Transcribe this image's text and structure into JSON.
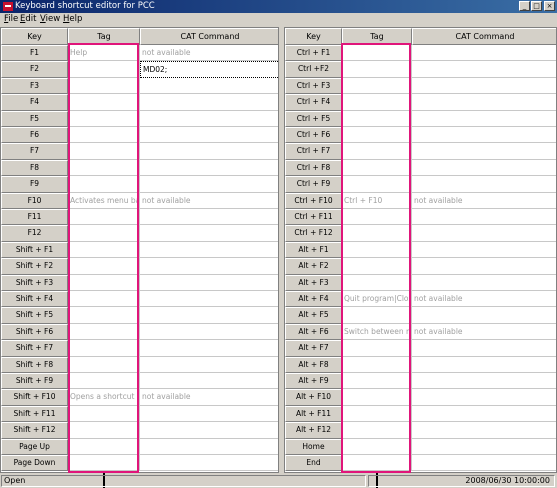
{
  "window": {
    "title": "Keyboard shortcut editor for PCC",
    "buttons": [
      "_",
      "□",
      "×"
    ]
  },
  "menu": [
    "File",
    "Edit",
    "View",
    "Help"
  ],
  "columns": [
    "Key",
    "Tag",
    "CAT Command"
  ],
  "left_table": {
    "rows": [
      {
        "key": "F1",
        "tag": "Help",
        "cat": "not available"
      },
      {
        "key": "F2",
        "tag": "",
        "cat": "MD02;"
      },
      {
        "key": "F3",
        "tag": "",
        "cat": ""
      },
      {
        "key": "F4",
        "tag": "",
        "cat": ""
      },
      {
        "key": "F5",
        "tag": "",
        "cat": ""
      },
      {
        "key": "F6",
        "tag": "",
        "cat": ""
      },
      {
        "key": "F7",
        "tag": "",
        "cat": ""
      },
      {
        "key": "F8",
        "tag": "",
        "cat": ""
      },
      {
        "key": "F9",
        "tag": "",
        "cat": ""
      },
      {
        "key": "F10",
        "tag": "Activates menu bar",
        "cat": "not available"
      },
      {
        "key": "F11",
        "tag": "",
        "cat": ""
      },
      {
        "key": "F12",
        "tag": "",
        "cat": ""
      },
      {
        "key": "Shift + F1",
        "tag": "",
        "cat": ""
      },
      {
        "key": "Shift + F2",
        "tag": "",
        "cat": ""
      },
      {
        "key": "Shift + F3",
        "tag": "",
        "cat": ""
      },
      {
        "key": "Shift + F4",
        "tag": "",
        "cat": ""
      },
      {
        "key": "Shift + F5",
        "tag": "",
        "cat": ""
      },
      {
        "key": "Shift + F6",
        "tag": "",
        "cat": ""
      },
      {
        "key": "Shift + F7",
        "tag": "",
        "cat": ""
      },
      {
        "key": "Shift + F8",
        "tag": "",
        "cat": ""
      },
      {
        "key": "Shift + F9",
        "tag": "",
        "cat": ""
      },
      {
        "key": "Shift + F10",
        "tag": "Opens a shortcut m",
        "cat": "not available"
      },
      {
        "key": "Shift + F11",
        "tag": "",
        "cat": ""
      },
      {
        "key": "Shift + F12",
        "tag": "",
        "cat": ""
      },
      {
        "key": "Page Up",
        "tag": "",
        "cat": ""
      },
      {
        "key": "Page Down",
        "tag": "",
        "cat": ""
      }
    ]
  },
  "right_table": {
    "rows": [
      {
        "key": "Ctrl + F1",
        "tag": "",
        "cat": ""
      },
      {
        "key": "Ctrl +F2",
        "tag": "",
        "cat": ""
      },
      {
        "key": "Ctrl + F3",
        "tag": "",
        "cat": ""
      },
      {
        "key": "Ctrl + F4",
        "tag": "",
        "cat": ""
      },
      {
        "key": "Ctrl + F5",
        "tag": "",
        "cat": ""
      },
      {
        "key": "Ctrl + F6",
        "tag": "",
        "cat": ""
      },
      {
        "key": "Ctrl + F7",
        "tag": "",
        "cat": ""
      },
      {
        "key": "Ctrl + F8",
        "tag": "",
        "cat": ""
      },
      {
        "key": "Ctrl + F9",
        "tag": "",
        "cat": ""
      },
      {
        "key": "Ctrl + F10",
        "tag": "Ctrl + F10",
        "cat": "not available"
      },
      {
        "key": "Ctrl + F11",
        "tag": "",
        "cat": ""
      },
      {
        "key": "Ctrl + F12",
        "tag": "",
        "cat": ""
      },
      {
        "key": "Alt + F1",
        "tag": "",
        "cat": ""
      },
      {
        "key": "Alt + F2",
        "tag": "",
        "cat": ""
      },
      {
        "key": "Alt + F3",
        "tag": "",
        "cat": ""
      },
      {
        "key": "Alt + F4",
        "tag": "Quit program|Closes",
        "cat": "not available"
      },
      {
        "key": "Alt + F5",
        "tag": "",
        "cat": ""
      },
      {
        "key": "Alt + F6",
        "tag": "Switch between mul",
        "cat": "not available"
      },
      {
        "key": "Alt + F7",
        "tag": "",
        "cat": ""
      },
      {
        "key": "Alt + F8",
        "tag": "",
        "cat": ""
      },
      {
        "key": "Alt + F9",
        "tag": "",
        "cat": ""
      },
      {
        "key": "Alt + F10",
        "tag": "",
        "cat": ""
      },
      {
        "key": "Alt + F11",
        "tag": "",
        "cat": ""
      },
      {
        "key": "Alt + F12",
        "tag": "",
        "cat": ""
      },
      {
        "key": "Home",
        "tag": "",
        "cat": ""
      },
      {
        "key": "End",
        "tag": "",
        "cat": ""
      }
    ]
  },
  "status": {
    "left": "Open",
    "right": "2008/06/30 10:00:00"
  },
  "colors": {
    "highlight": "#e0157a",
    "titlebar": "#0a246a"
  }
}
